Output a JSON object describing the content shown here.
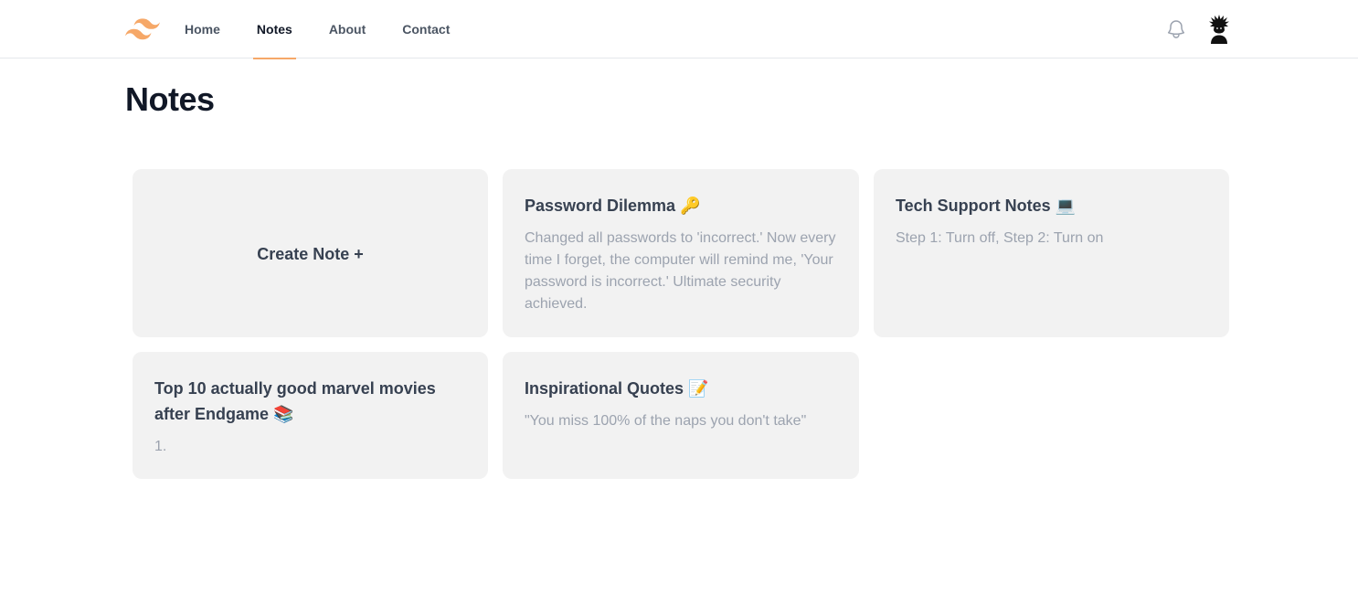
{
  "nav": {
    "items": [
      {
        "label": "Home",
        "active": false
      },
      {
        "label": "Notes",
        "active": true
      },
      {
        "label": "About",
        "active": false
      },
      {
        "label": "Contact",
        "active": false
      }
    ],
    "accent_color": "#f6a868",
    "logo_icon": "tailwind-logo-icon",
    "notification_icon": "bell-icon",
    "avatar_icon": "avatar-silhouette-icon"
  },
  "page": {
    "title": "Notes"
  },
  "create_card": {
    "label": "Create Note +"
  },
  "notes": [
    {
      "title": "Password Dilemma 🔑",
      "body": "Changed all passwords to 'incorrect.' Now every time I forget, the computer will remind me, 'Your password is incorrect.' Ultimate security achieved."
    },
    {
      "title": "Tech Support Notes 💻",
      "body": "Step 1: Turn off, Step 2: Turn on"
    },
    {
      "title": "Top 10 actually good marvel movies after Endgame 📚",
      "body": "1."
    },
    {
      "title": "Inspirational Quotes 📝",
      "body": "\"You miss 100% of the naps you don't take\""
    }
  ]
}
